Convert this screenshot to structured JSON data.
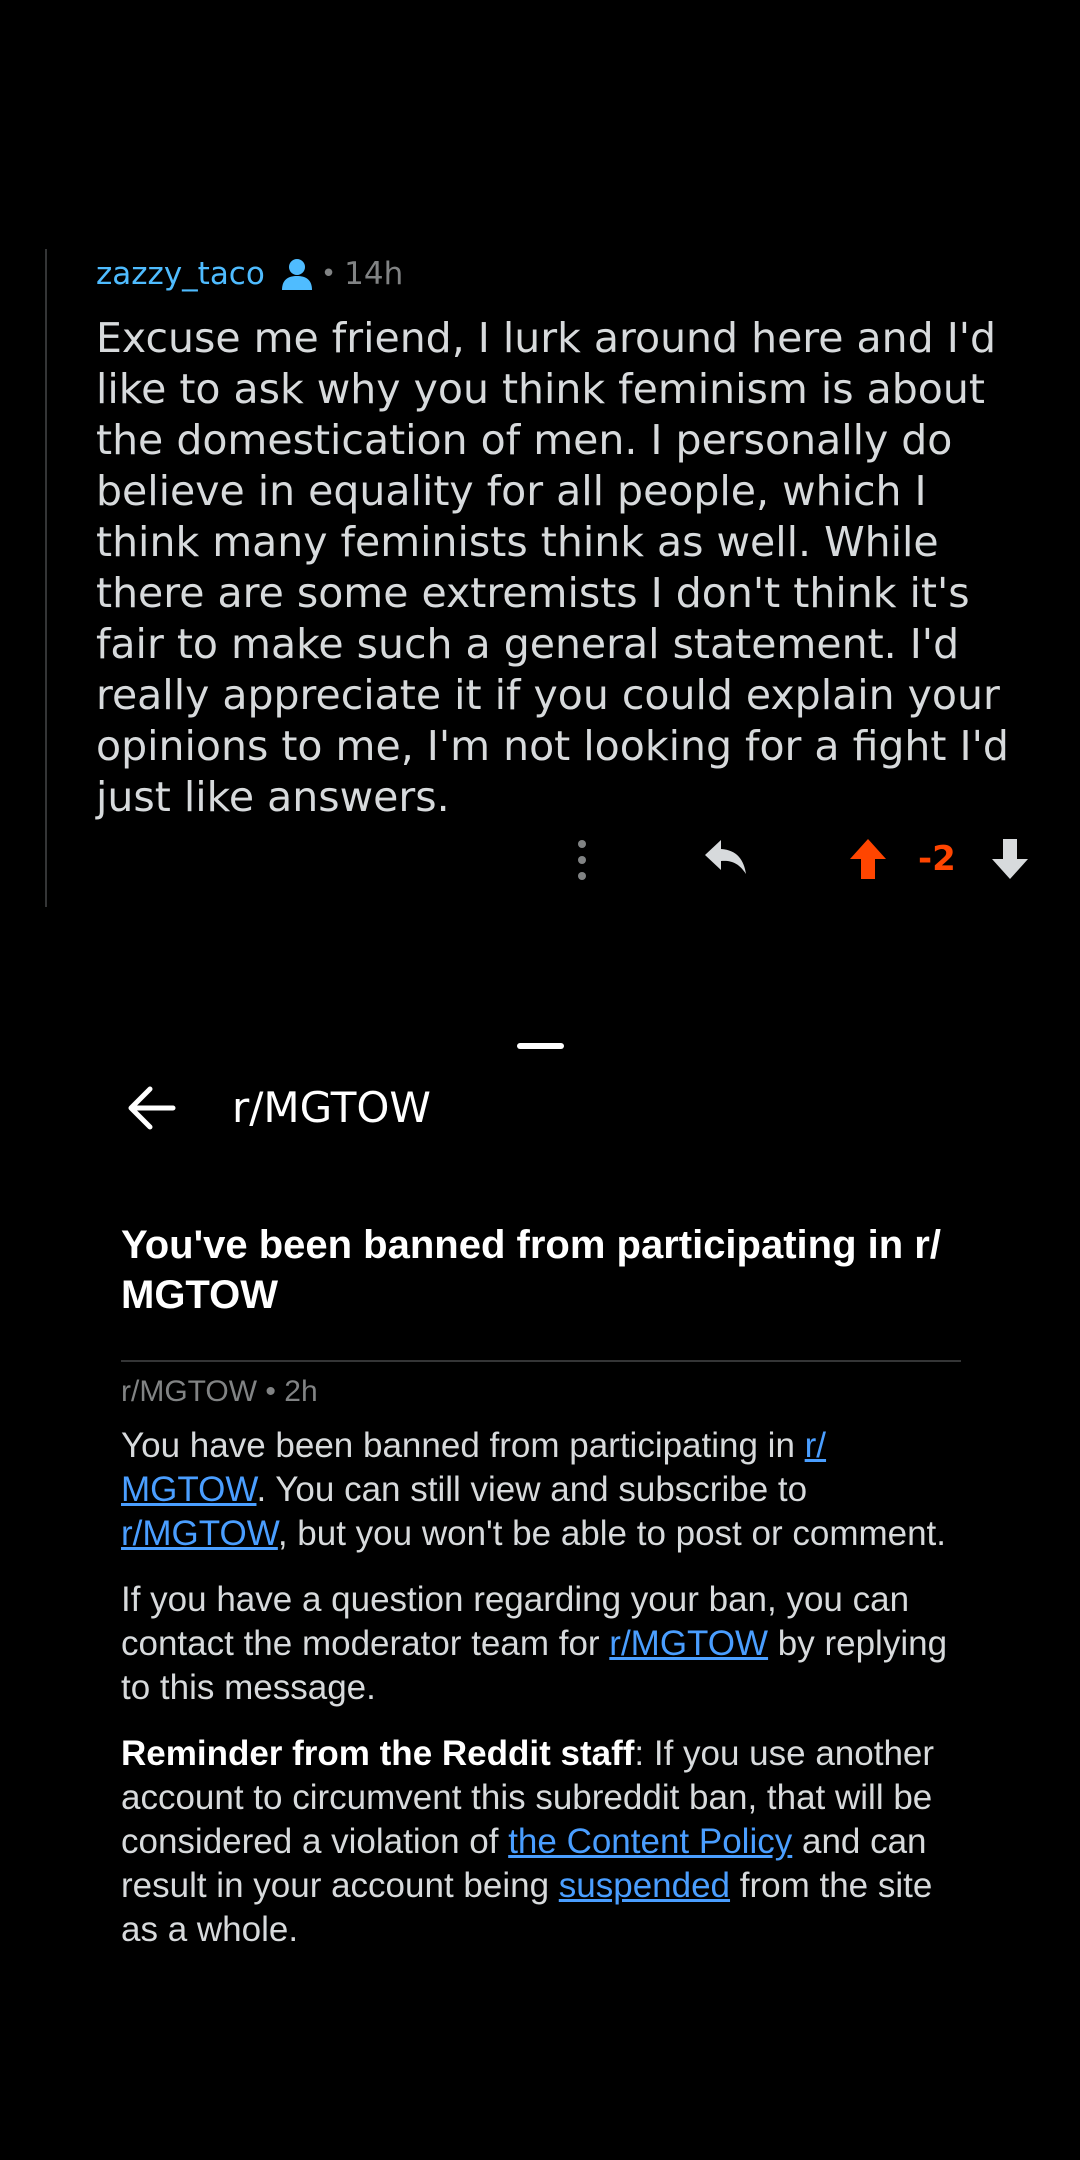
{
  "comment": {
    "username": "zazzy_taco",
    "op_badge_icon": "person-icon",
    "separator": "•",
    "time": "14h",
    "body": "Excuse me friend, I lurk around here and I'd like to ask why you think feminism is about the domestication of men. I personally do believe in equality for all people, which I think many feminists think as well. While there are some extremists I don't think it's fair to make such a general statement. I'd really appreciate it if you could explain your opinions to me, I'm not looking for a fight I'd just like answers.",
    "score": "-2",
    "colors": {
      "username": "#4fbcff",
      "upvote": "#ff4500",
      "score": "#ff4500"
    }
  },
  "message": {
    "header_title": "r/MGTOW",
    "subject": "You've been banned from participating in r/ MGTOW",
    "meta": "r/MGTOW • 2h",
    "p1_prefix": "You have been banned from participating in ",
    "p1_link1": "r/ MGTOW",
    "p1_mid": ". You can still view and subscribe to ",
    "p1_link2": "r/MGTOW",
    "p1_suffix": ", but you won't be able to post or comment.",
    "p2_prefix": "If you have a question regarding your ban, you can contact the moderator team for ",
    "p2_link": "r/MGTOW",
    "p2_suffix": " by replying to this message.",
    "p3_bold": "Reminder from the Reddit staff",
    "p3_text1": ": If you use another account to circumvent this subreddit ban, that will be considered a violation of ",
    "p3_link1": "the Content Policy",
    "p3_text2": " and can result in your account being ",
    "p3_link2": "suspended",
    "p3_text3": " from the site as a whole.",
    "colors": {
      "link": "#4a9eff"
    }
  }
}
